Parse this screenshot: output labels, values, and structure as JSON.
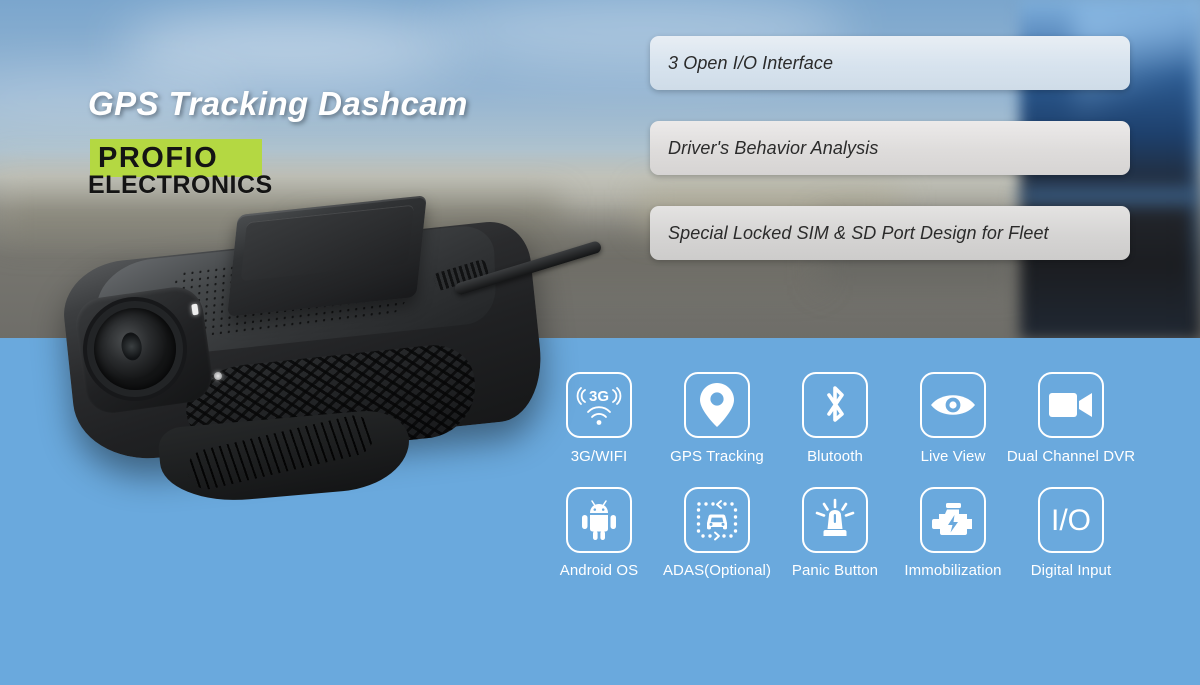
{
  "banner": {
    "headline": "GPS Tracking Dashcam",
    "logo": {
      "main": "PROFIO",
      "sub": "ELECTRONICS",
      "background_color": "#b4d842",
      "text_color": "#141414"
    },
    "panel_color": "#6aa9dd",
    "product_name": "dashcam-product-photo"
  },
  "feature_bars": [
    {
      "label": "3 Open I/O Interface"
    },
    {
      "label": "Driver's Behavior Analysis"
    },
    {
      "label": "Special Locked SIM & SD Port Design for Fleet"
    }
  ],
  "features": {
    "row1": [
      {
        "label": "3G/WIFI",
        "icon": "3g-wifi-icon",
        "glyph": "3G"
      },
      {
        "label": "GPS Tracking",
        "icon": "map-pin-icon"
      },
      {
        "label": "Blutooth",
        "icon": "bluetooth-icon"
      },
      {
        "label": "Live View",
        "icon": "eye-icon"
      },
      {
        "label": "Dual Channel DVR",
        "icon": "video-camera-icon"
      }
    ],
    "row2": [
      {
        "label": "Android OS",
        "icon": "android-icon"
      },
      {
        "label": "ADAS(Optional)",
        "icon": "adas-car-lane-icon"
      },
      {
        "label": "Panic Button",
        "icon": "siren-beacon-icon"
      },
      {
        "label": "Immobilization",
        "icon": "engine-bolt-icon"
      },
      {
        "label": "Digital Input",
        "icon": "io-text-icon",
        "glyph": "I/O"
      }
    ]
  }
}
